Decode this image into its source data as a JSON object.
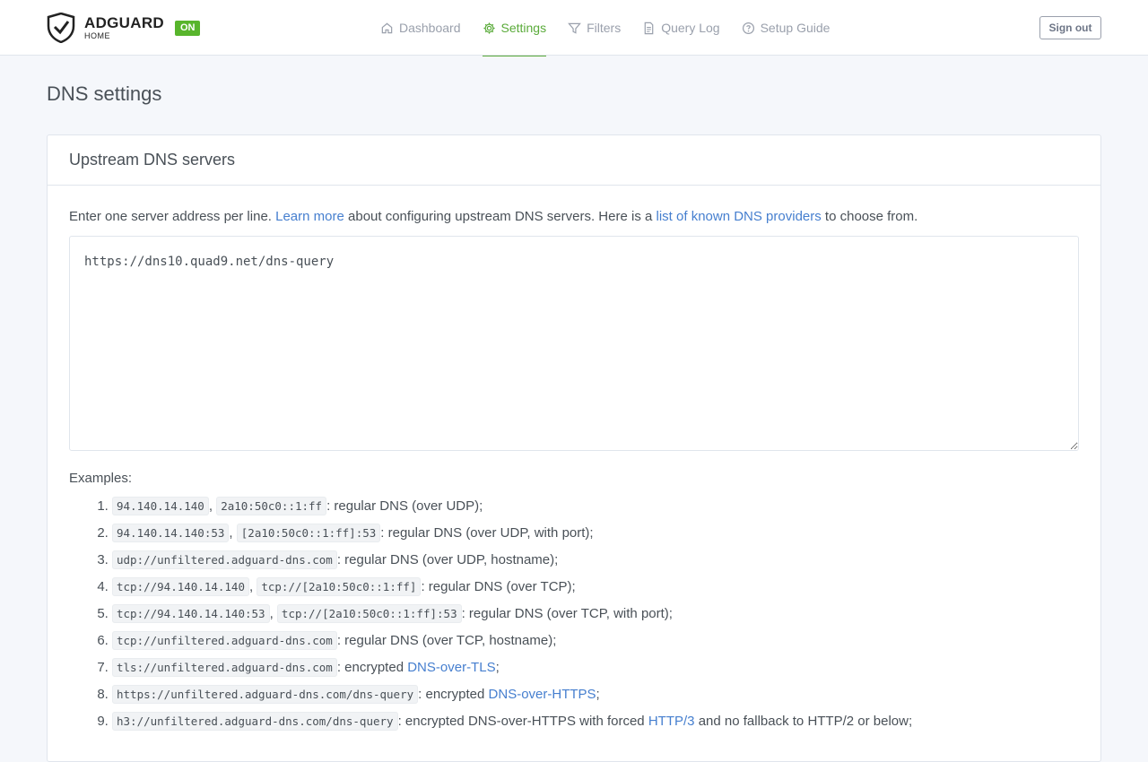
{
  "brand": {
    "name": "ADGUARD",
    "sub": "HOME",
    "status_badge": "ON"
  },
  "nav": [
    {
      "label": "Dashboard",
      "icon": "home-icon",
      "active": false
    },
    {
      "label": "Settings",
      "icon": "gear-icon",
      "active": true
    },
    {
      "label": "Filters",
      "icon": "filter-icon",
      "active": false
    },
    {
      "label": "Query Log",
      "icon": "document-icon",
      "active": false
    },
    {
      "label": "Setup Guide",
      "icon": "help-circle-icon",
      "active": false
    }
  ],
  "signout_label": "Sign out",
  "page_title": "DNS settings",
  "card": {
    "title": "Upstream DNS servers",
    "intro": {
      "text1": "Enter one server address per line.",
      "link1": "Learn more",
      "text2": "about configuring upstream DNS servers. Here is a",
      "link2": "list of known DNS providers",
      "text3": "to choose from."
    },
    "upstream_value": "https://dns10.quad9.net/dns-query",
    "examples_label": "Examples:",
    "examples": [
      {
        "codes": [
          "94.140.14.140",
          "2a10:50c0::1:ff"
        ],
        "desc": ": regular DNS (over UDP);"
      },
      {
        "codes": [
          "94.140.14.140:53",
          "[2a10:50c0::1:ff]:53"
        ],
        "desc": ": regular DNS (over UDP, with port);"
      },
      {
        "codes": [
          "udp://unfiltered.adguard-dns.com"
        ],
        "desc": ": regular DNS (over UDP, hostname);"
      },
      {
        "codes": [
          "tcp://94.140.14.140",
          "tcp://[2a10:50c0::1:ff]"
        ],
        "desc": ": regular DNS (over TCP);"
      },
      {
        "codes": [
          "tcp://94.140.14.140:53",
          "tcp://[2a10:50c0::1:ff]:53"
        ],
        "desc": ": regular DNS (over TCP, with port);"
      },
      {
        "codes": [
          "tcp://unfiltered.adguard-dns.com"
        ],
        "desc": ": regular DNS (over TCP, hostname);"
      },
      {
        "codes": [
          "tls://unfiltered.adguard-dns.com"
        ],
        "desc": ": encrypted",
        "link": "DNS-over-TLS",
        "after": ";"
      },
      {
        "codes": [
          "https://unfiltered.adguard-dns.com/dns-query"
        ],
        "desc": ": encrypted",
        "link": "DNS-over-HTTPS",
        "after": ";"
      },
      {
        "codes": [
          "h3://unfiltered.adguard-dns.com/dns-query"
        ],
        "desc": ": encrypted DNS-over-HTTPS with forced",
        "link": "HTTP/3",
        "after": "and no fallback to HTTP/2 or below;"
      }
    ]
  },
  "colors": {
    "accent": "#5aab3a",
    "link": "#467fcf",
    "badge": "#58b52c"
  }
}
